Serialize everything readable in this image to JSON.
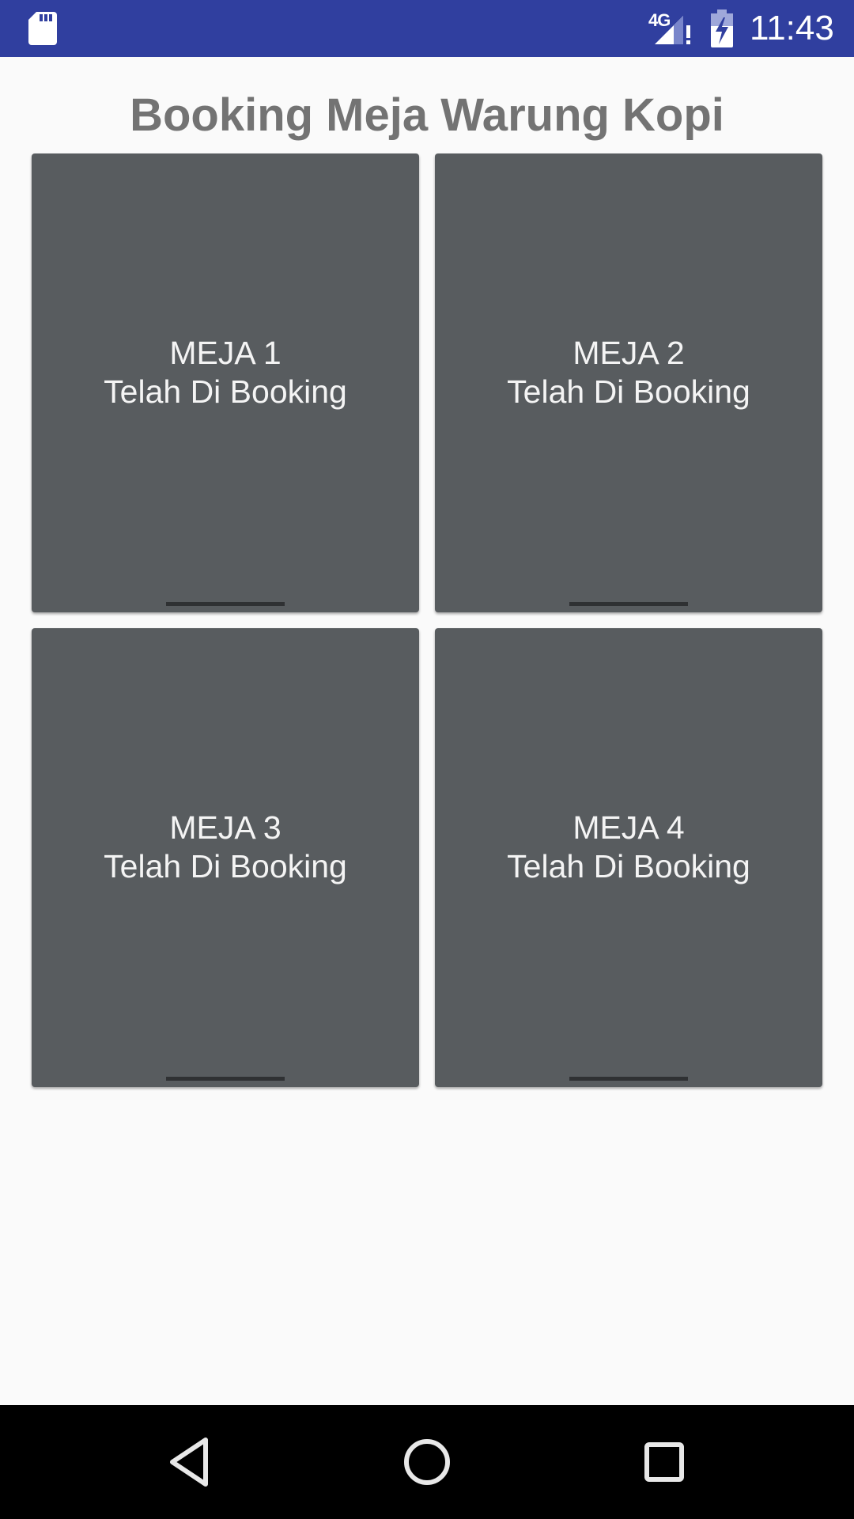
{
  "status_bar": {
    "background": "#303f9f",
    "network_type": "4G",
    "time": "11:43",
    "icons": [
      "sd-card-icon",
      "signal-icon",
      "battery-charging-icon"
    ]
  },
  "page": {
    "title": "Booking Meja Warung Kopi"
  },
  "tables": [
    {
      "name": "MEJA 1",
      "status": "Telah Di Booking"
    },
    {
      "name": "MEJA 2",
      "status": "Telah Di Booking"
    },
    {
      "name": "MEJA 3",
      "status": "Telah Di Booking"
    },
    {
      "name": "MEJA 4",
      "status": "Telah Di Booking"
    }
  ],
  "colors": {
    "card_background": "#585c5f",
    "page_background": "#fafafa",
    "title_text": "#737373"
  },
  "nav_bar": {
    "icons": [
      "back-icon",
      "home-icon",
      "recents-icon"
    ]
  }
}
